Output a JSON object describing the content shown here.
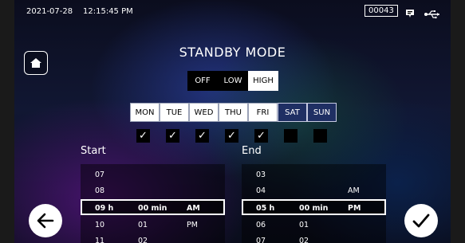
{
  "status_bar": {
    "date": "2021-07-28",
    "time": "12:15:45 PM",
    "counter": "00043",
    "icons": [
      "message-icon",
      "usb-icon"
    ]
  },
  "title": "STANDBY MODE",
  "mode_buttons": {
    "off": "OFF",
    "low": "LOW",
    "high": "HIGH",
    "selected": "HIGH"
  },
  "days": [
    {
      "label": "MON",
      "checked": true
    },
    {
      "label": "TUE",
      "checked": true
    },
    {
      "label": "WED",
      "checked": true
    },
    {
      "label": "THU",
      "checked": true
    },
    {
      "label": "FRI",
      "checked": true
    },
    {
      "label": "SAT",
      "checked": false
    },
    {
      "label": "SUN",
      "checked": false
    }
  ],
  "check_mark": "✓",
  "start": {
    "label": "Start",
    "rows": [
      {
        "h": "07",
        "m": "",
        "ap": ""
      },
      {
        "h": "08",
        "m": "",
        "ap": ""
      },
      {
        "h": "09 h",
        "m": "00 min",
        "ap": "AM"
      },
      {
        "h": "10",
        "m": "01",
        "ap": "PM"
      },
      {
        "h": "11",
        "m": "02",
        "ap": ""
      }
    ]
  },
  "end": {
    "label": "End",
    "rows": [
      {
        "h": "03",
        "m": "",
        "ap": ""
      },
      {
        "h": "04",
        "m": "",
        "ap": "AM"
      },
      {
        "h": "05 h",
        "m": "00 min",
        "ap": "PM"
      },
      {
        "h": "06",
        "m": "01",
        "ap": ""
      },
      {
        "h": "07",
        "m": "02",
        "ap": ""
      }
    ]
  },
  "icons": {
    "home": "home-icon",
    "back": "arrow-left-icon",
    "confirm": "checkmark-icon"
  }
}
